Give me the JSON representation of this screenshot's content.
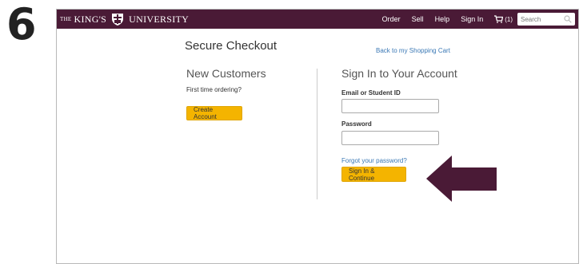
{
  "step": {
    "number": "6"
  },
  "logo": {
    "prefix": "THE",
    "name1": "KING'S",
    "name2": "UNIVERSITY"
  },
  "nav": {
    "links": [
      "Order",
      "Sell",
      "Help",
      "Sign In"
    ],
    "cart_count": "(1)",
    "search_placeholder": "Search"
  },
  "checkout": {
    "title": "Secure Checkout",
    "back_link": "Back to my Shopping Cart",
    "new_customers": {
      "heading": "New Customers",
      "subtext": "First time ordering?",
      "button": "Create Account"
    },
    "sign_in": {
      "heading": "Sign In to Your Account",
      "email_label": "Email or Student ID",
      "password_label": "Password",
      "forgot": "Forgot your password?",
      "button": "Sign In & Continue"
    }
  },
  "colors": {
    "nav_bg": "#4a1a36",
    "button": "#f4b400",
    "link": "#3a78b5",
    "arrow": "#4a1a36"
  }
}
